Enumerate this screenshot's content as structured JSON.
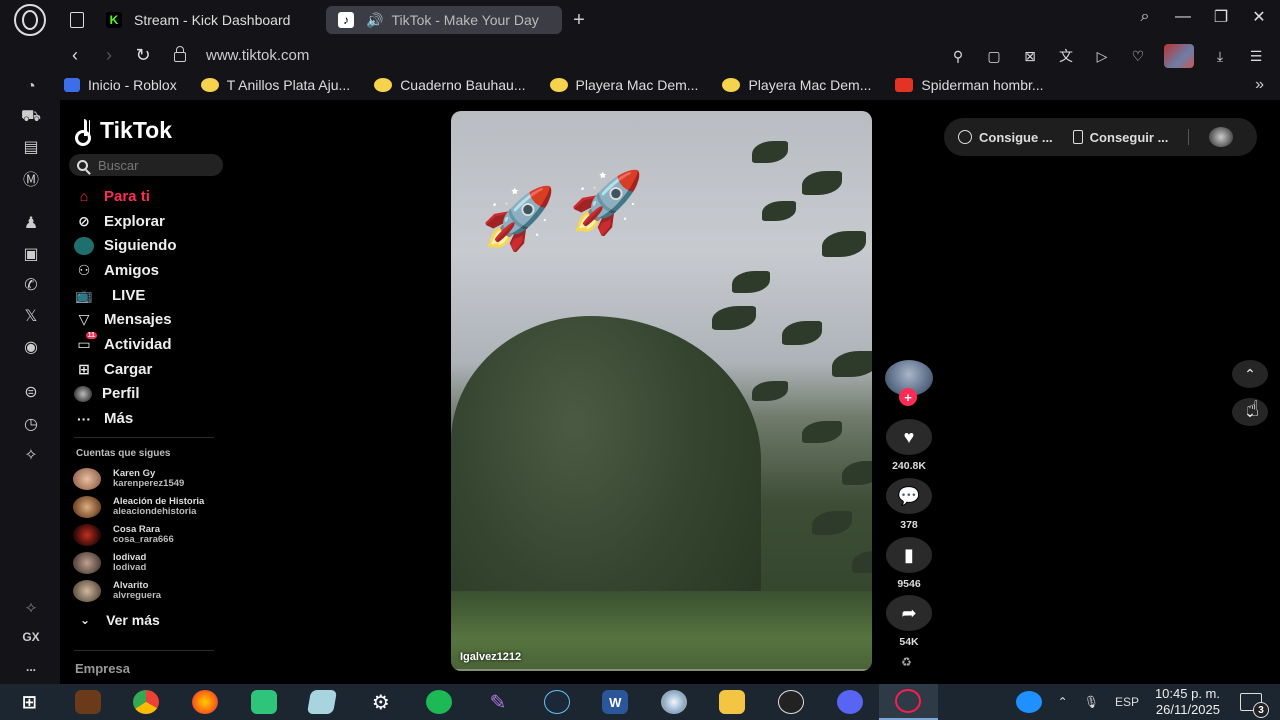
{
  "browser": {
    "tabs": [
      {
        "label": "Stream - Kick Dashboard",
        "favicon": "kick-icon",
        "favicon_color": "#53fc18",
        "active": false
      },
      {
        "label": "TikTok - Make Your Day",
        "favicon": "tiktok-icon",
        "active": true
      }
    ],
    "url": "www.tiktok.com",
    "bookmarks": [
      {
        "label": "Inicio - Roblox",
        "icon": "roblox-icon",
        "color": "#3b6ee8"
      },
      {
        "label": "T Anillos Plata Aju...",
        "icon": "mercadolibre-icon",
        "color": "#f5d34c"
      },
      {
        "label": "Cuaderno Bauhau...",
        "icon": "mercadolibre-icon",
        "color": "#f5d34c"
      },
      {
        "label": "Playera Mac Dem...",
        "icon": "mercadolibre-icon",
        "color": "#f5d34c"
      },
      {
        "label": "Playera Mac Dem...",
        "icon": "mercadolibre-icon",
        "color": "#f5d34c"
      },
      {
        "label": "Spiderman hombr...",
        "icon": "aliexpress-icon",
        "color": "#e43225"
      }
    ]
  },
  "sidebar_gx": {
    "gx_label": "GX",
    "more": "..."
  },
  "tiktok": {
    "logo_text": "TikTok",
    "search_placeholder": "Buscar",
    "nav": [
      {
        "label": "Para ti",
        "icon": "home-icon",
        "active": true
      },
      {
        "label": "Explorar",
        "icon": "compass-icon"
      },
      {
        "label": "Siguiendo",
        "icon": "following-icon"
      },
      {
        "label": "Amigos",
        "icon": "friends-icon"
      },
      {
        "label": "LIVE",
        "icon": "live-icon"
      },
      {
        "label": "Mensajes",
        "icon": "messages-icon"
      },
      {
        "label": "Actividad",
        "icon": "activity-icon",
        "badge": "11"
      },
      {
        "label": "Cargar",
        "icon": "upload-icon"
      },
      {
        "label": "Perfil",
        "icon": "profile-icon"
      },
      {
        "label": "Más",
        "icon": "more-icon"
      }
    ],
    "following_title": "Cuentas que sigues",
    "following": [
      {
        "name": "Karen Gy",
        "handle": "karenperez1549"
      },
      {
        "name": "Aleación de Historia",
        "handle": "aleaciondehistoria"
      },
      {
        "name": "Cosa Rara",
        "handle": "cosa_rara666"
      },
      {
        "name": "Iodivad",
        "handle": "Iodivad"
      },
      {
        "name": "Alvarito",
        "handle": "alvreguera"
      }
    ],
    "see_more": "Ver más",
    "company": "Empresa",
    "video": {
      "username": "Igalvez1212"
    },
    "actions": {
      "likes": "240.8K",
      "comments": "378",
      "saves": "9546",
      "shares": "54K"
    },
    "top_right": {
      "btn1": "Consigue ...",
      "btn2": "Conseguir ..."
    }
  },
  "taskbar": {
    "apps": [
      "start-icon",
      "fnaf-icon",
      "chrome-icon",
      "firefox-icon",
      "green-app-icon",
      "box-icon",
      "settings-icon",
      "spotify-icon",
      "feather-icon",
      "steam-icon",
      "word-icon",
      "paint-icon",
      "folder-icon",
      "obs-icon",
      "discord-icon",
      "opera-gx-icon"
    ],
    "lang": "ESP",
    "time": "10:45 p. m.",
    "date": "26/11/2025",
    "notifications": "3"
  }
}
